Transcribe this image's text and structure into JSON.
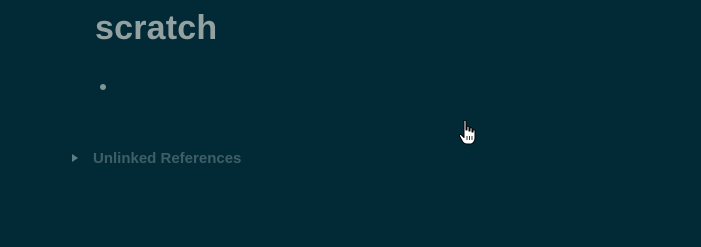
{
  "page": {
    "title": "scratch"
  },
  "references": {
    "unlinked_label": "Unlinked References"
  },
  "icons": {
    "bullet": "bullet-dot",
    "caret": "caret-right-icon",
    "cursor": "hand-pointer-cursor"
  },
  "colors": {
    "background": "#022a36",
    "title": "#93a1a1",
    "bullet": "#839496",
    "muted_text": "#3f5f68"
  }
}
